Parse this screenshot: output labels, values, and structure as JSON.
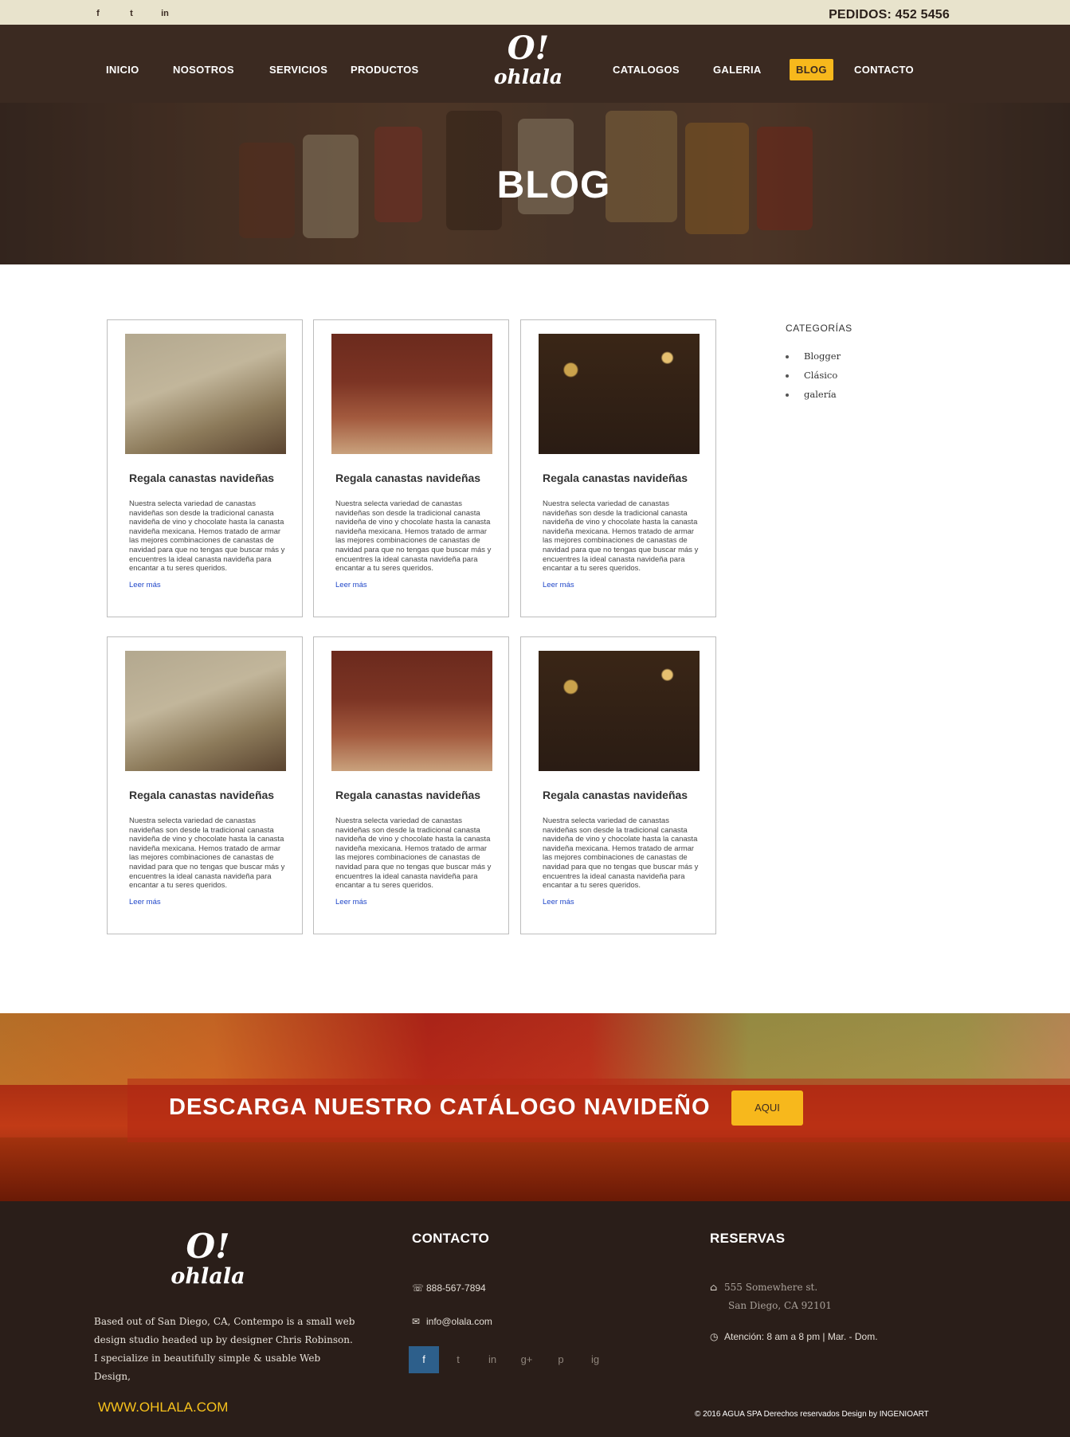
{
  "topbar": {
    "social": [
      {
        "icon": "facebook-icon",
        "glyph": "f"
      },
      {
        "icon": "twitter-icon",
        "glyph": "t"
      },
      {
        "icon": "linkedin-icon",
        "glyph": "in"
      }
    ],
    "phone": "PEDIDOS:  452 5456"
  },
  "nav": {
    "items": [
      "INICIO",
      "NOSOTROS",
      "SERVICIOS",
      "PRODUCTOS",
      "CATALOGOS",
      "GALERIA",
      "BLOG",
      "CONTACTO"
    ],
    "active": "BLOG",
    "active_color": "#f7b81c",
    "logo_big": "O!",
    "logo_small": "ohlala"
  },
  "hero": {
    "title": "BLOG"
  },
  "posts": [
    {
      "title": "Regala canastas navideñas",
      "text": "Nuestra selecta variedad de canastas navideñas son desde la tradicional canasta navideña de vino y chocolate hasta la canasta navideña mexicana. Hemos tratado de armar las mejores combinaciones de canastas de navidad para que no tengas que buscar más y encuentres la ideal canasta navideña para encantar a tu seres queridos.",
      "more": "Leer más"
    },
    {
      "title": "Regala canastas navideñas",
      "text": "Nuestra selecta variedad de canastas navideñas son desde la tradicional canasta navideña de vino y chocolate hasta la canasta navideña mexicana. Hemos tratado de armar las mejores combinaciones de canastas de navidad para que no tengas que buscar más y encuentres la ideal canasta navideña para encantar a tu seres queridos.",
      "more": "Leer más"
    },
    {
      "title": "Regala canastas navideñas",
      "text": "Nuestra selecta variedad de canastas navideñas son desde la tradicional canasta navideña de vino y chocolate hasta la canasta navideña mexicana. Hemos tratado de armar las mejores combinaciones de canastas de navidad para que no tengas que buscar más y encuentres la ideal canasta navideña para encantar a tu seres queridos.",
      "more": "Leer más"
    },
    {
      "title": "Regala canastas navideñas",
      "text": "Nuestra selecta variedad de canastas navideñas son desde la tradicional canasta navideña de vino y chocolate hasta la canasta navideña mexicana. Hemos tratado de armar las mejores combinaciones de canastas de navidad para que no tengas que buscar más y encuentres la ideal canasta navideña para encantar a tu seres queridos.",
      "more": "Leer más"
    },
    {
      "title": "Regala canastas navideñas",
      "text": "Nuestra selecta variedad de canastas navideñas son desde la tradicional canasta navideña de vino y chocolate hasta la canasta navideña mexicana. Hemos tratado de armar las mejores combinaciones de canastas de navidad para que no tengas que buscar más y encuentres la ideal canasta navideña para encantar a tu seres queridos.",
      "more": "Leer más"
    },
    {
      "title": "Regala canastas navideñas",
      "text": "Nuestra selecta variedad de canastas navideñas son desde la tradicional canasta navideña de vino y chocolate hasta la canasta navideña mexicana. Hemos tratado de armar las mejores combinaciones de canastas de navidad para que no tengas que buscar más y encuentres la ideal canasta navideña para encantar a tu seres queridos.",
      "more": "Leer más"
    }
  ],
  "sidebar": {
    "title": "CATEGORÍAS",
    "items": [
      "Blogger",
      "Clásico",
      "galería"
    ]
  },
  "banner": {
    "title": "DESCARGA NUESTRO CATÁLOGO NAVIDEÑO",
    "button": "AQUI"
  },
  "footer": {
    "logo_big": "O!",
    "logo_small": "ohlala",
    "about": "Based out of San Diego, CA, Contempo is a small web design studio headed up by designer Chris Robinson. I specialize in beautifully simple & usable Web Design,",
    "website": "WWW.OHLALA.COM",
    "contact_title": "CONTACTO",
    "phone": "888-567-7894",
    "email": "info@olala.com",
    "reservas_title": "RESERVAS",
    "address1": "555 Somewhere st.",
    "address2": "San Diego, CA 92101",
    "hours": "Atención: 8 am a 8 pm  |  Mar. - Dom.",
    "social": [
      "f",
      "t",
      "in",
      "g+",
      "p",
      "ig"
    ],
    "copyright": "© 2016   AGUA SPA   Derechos reservados Design by INGENIOART"
  }
}
